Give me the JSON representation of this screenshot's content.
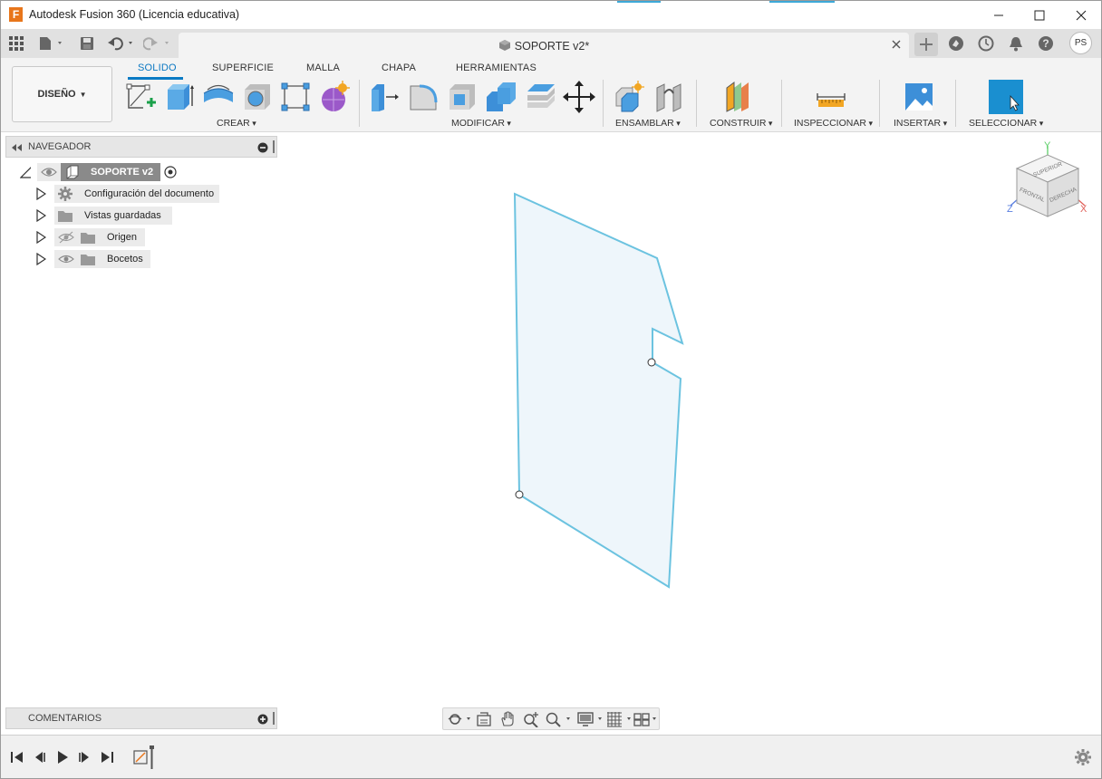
{
  "window": {
    "title": "Autodesk Fusion 360 (Licencia educativa)",
    "logo_letter": "F"
  },
  "document_tab": {
    "title": "SOPORTE v2*"
  },
  "user": {
    "initials": "PS"
  },
  "toolbar": {
    "design_label": "DISEÑO",
    "workspace_tabs": [
      "SOLIDO",
      "SUPERFICIE",
      "MALLA",
      "CHAPA",
      "HERRAMIENTAS"
    ],
    "active_tab": "SOLIDO",
    "groups": {
      "crear": "CREAR",
      "modificar": "MODIFICAR",
      "ensamblar": "ENSAMBLAR",
      "construir": "CONSTRUIR",
      "inspeccionar": "INSPECCIONAR",
      "insertar": "INSERTAR",
      "seleccionar": "SELECCIONAR"
    }
  },
  "navigator": {
    "header": "NAVEGADOR",
    "root": "SOPORTE v2",
    "items": [
      {
        "label": "Configuración del documento",
        "icon": "gear-icon"
      },
      {
        "label": "Vistas guardadas",
        "icon": "folder-icon"
      },
      {
        "label": "Origen",
        "icon": "folder-icon",
        "visibility": "hidden"
      },
      {
        "label": "Bocetos",
        "icon": "folder-icon",
        "visibility": "visible"
      }
    ]
  },
  "comments": {
    "header": "COMENTARIOS"
  },
  "viewcube": {
    "faces": [
      "SUPERIOR",
      "FRONTAL",
      "DERECHA"
    ],
    "axes": {
      "x": "X",
      "y": "Y",
      "z": "Z"
    },
    "colors": {
      "x": "#e0615a",
      "y": "#5fcf6a",
      "z": "#5a7fe0"
    }
  },
  "colors": {
    "accent": "#0a7ac4",
    "sketch_stroke": "#6cc3e0",
    "sketch_fill": "#eef6fb",
    "select_highlight": "#1a8fd0"
  }
}
